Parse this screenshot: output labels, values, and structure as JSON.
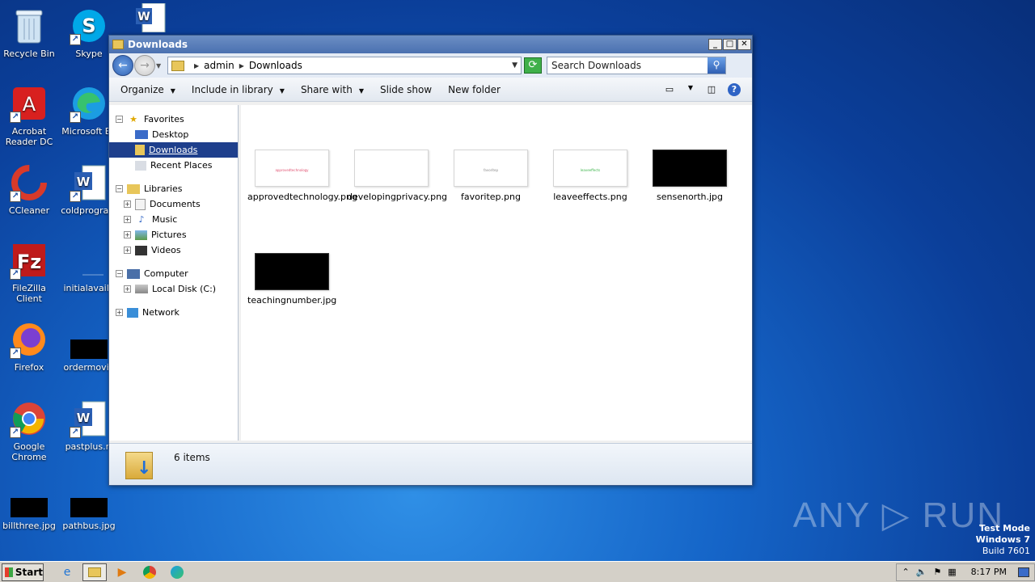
{
  "desktop": {
    "icons": [
      {
        "label": "Recycle Bin"
      },
      {
        "label": "Skype"
      },
      {
        "label": "Acrobat Reader DC"
      },
      {
        "label": "Microsoft Ed"
      },
      {
        "label": "CCleaner"
      },
      {
        "label": "coldprogra..."
      },
      {
        "label": "FileZilla Client"
      },
      {
        "label": "initialavaila"
      },
      {
        "label": "Firefox"
      },
      {
        "label": "ordermovie"
      },
      {
        "label": "Google Chrome"
      },
      {
        "label": "pastplus.rt"
      },
      {
        "label": "billthree.jpg"
      },
      {
        "label": "pathbus.jpg"
      }
    ]
  },
  "window": {
    "title": "Downloads",
    "controls": {
      "minimize": "_",
      "maximize": "□",
      "close": "✕"
    },
    "address": {
      "crumbs": [
        "admin",
        "Downloads"
      ]
    },
    "search": {
      "placeholder": "Search Downloads"
    },
    "toolbar": {
      "organize": "Organize",
      "include_in_library": "Include in library",
      "share_with": "Share with",
      "slide_show": "Slide show",
      "new_folder": "New folder"
    },
    "nav": {
      "favorites": "Favorites",
      "desktop": "Desktop",
      "downloads": "Downloads",
      "recent_places": "Recent Places",
      "libraries": "Libraries",
      "documents": "Documents",
      "music": "Music",
      "pictures": "Pictures",
      "videos": "Videos",
      "computer": "Computer",
      "local_disk": "Local Disk (C:)",
      "network": "Network"
    },
    "files": [
      {
        "name": "approvedtechnology.png",
        "thumb": "light",
        "text": "approvedtechnology",
        "color": "#e05070"
      },
      {
        "name": "developingprivacy.png",
        "thumb": "light",
        "text": "",
        "color": "#999999"
      },
      {
        "name": "favoritep.png",
        "thumb": "light",
        "text": "favoritep",
        "color": "#888888"
      },
      {
        "name": "leaveeffects.png",
        "thumb": "light",
        "text": "leaveeffects",
        "color": "#3cb44a"
      },
      {
        "name": "sensenorth.jpg",
        "thumb": "dark",
        "text": "",
        "color": "#000000"
      },
      {
        "name": "teachingnumber.jpg",
        "thumb": "dark",
        "text": "",
        "color": "#000000"
      }
    ],
    "status": {
      "count": "6 items"
    }
  },
  "watermark": {
    "text": "ANY ▷ RUN"
  },
  "os_info": {
    "line1": "Test Mode",
    "line2": "Windows 7",
    "line3": "Build 7601"
  },
  "taskbar": {
    "start": "Start",
    "clock": "8:17 PM"
  }
}
